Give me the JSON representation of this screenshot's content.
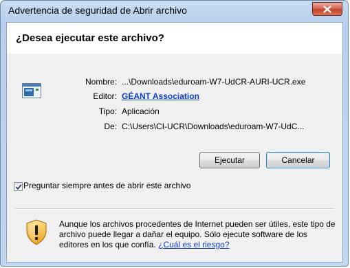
{
  "window": {
    "title": "Advertencia de seguridad de Abrir archivo"
  },
  "dialog": {
    "question": "¿Desea ejecutar este archivo?",
    "fields": {
      "name_label": "Nombre:",
      "name_value": "...\\Downloads\\eduroam-W7-UdCR-AURI-UCR.exe",
      "publisher_label": "Editor:",
      "publisher_value": "GÉANT Association",
      "type_label": "Tipo:",
      "type_value": "Aplicación",
      "from_label": "De:",
      "from_value": "C:\\Users\\CI-UCR\\Downloads\\eduroam-W7-UdC..."
    },
    "buttons": {
      "run": "Ejecutar",
      "cancel": "Cancelar"
    },
    "checkbox": {
      "label": "Preguntar siempre antes de abrir este archivo",
      "checked": true
    },
    "warning": {
      "text": "Aunque los archivos procedentes de Internet pueden ser útiles, este tipo de archivo puede llegar a dañar el equipo. Sólo ejecute software de los editores en los que confía.",
      "link": "¿Cuál es el riesgo?"
    }
  },
  "icons": {
    "close": "close-icon",
    "file": "application-file-icon",
    "shield": "security-shield-icon",
    "check": "checkmark-icon"
  },
  "colors": {
    "title_bar": "#b9d1ee",
    "close_button": "#c3432c",
    "link": "#0a3dc4",
    "dialog_body": "#f0f0f0",
    "header_band": "#ffffff"
  }
}
